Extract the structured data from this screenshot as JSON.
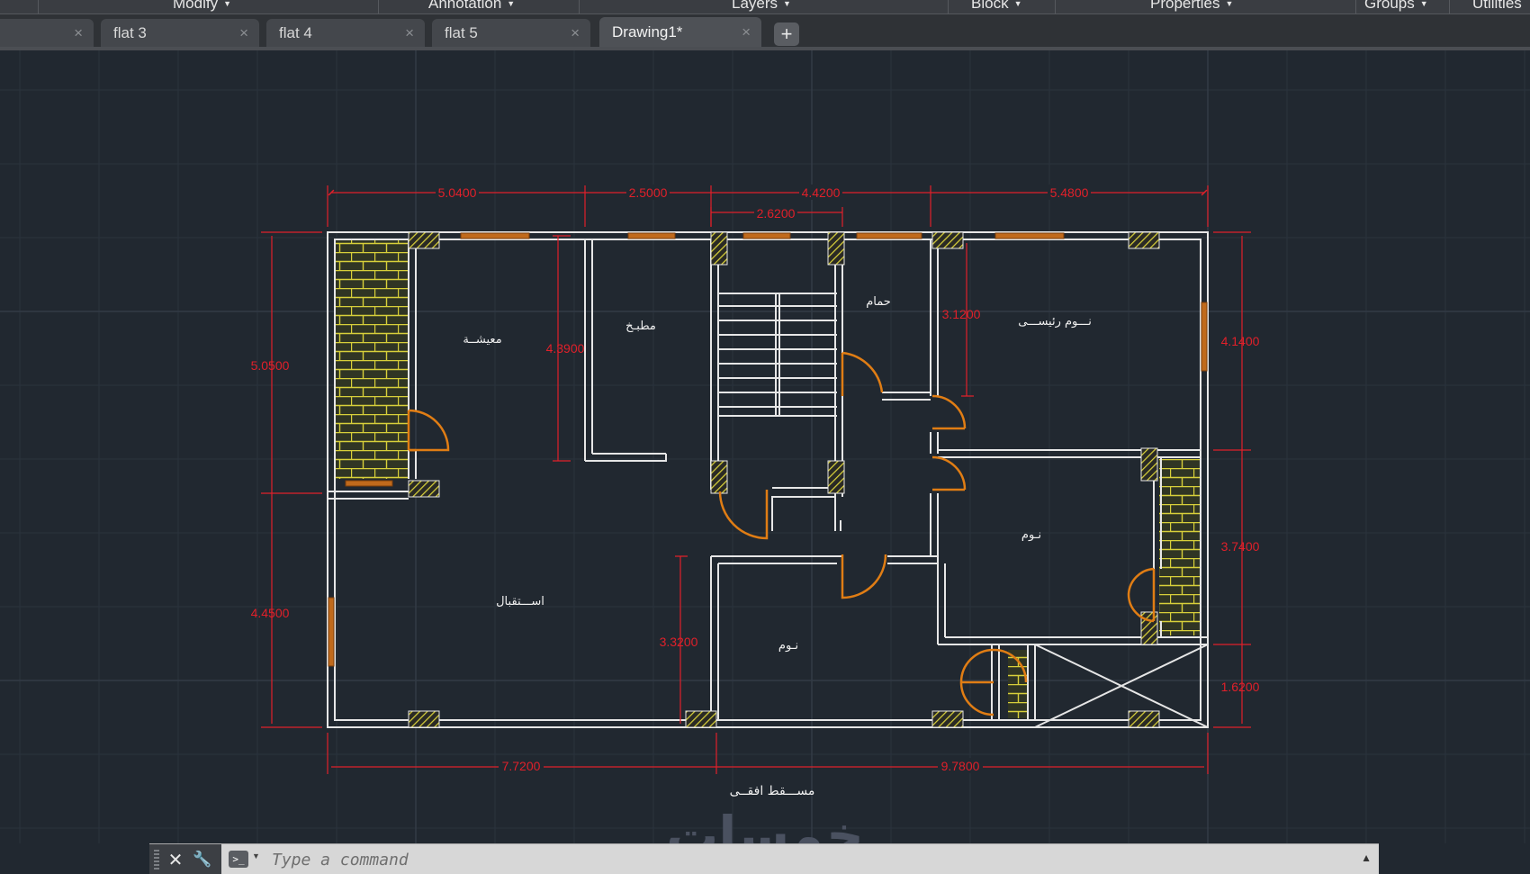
{
  "ribbon": {
    "panels": [
      {
        "label": "Modify"
      },
      {
        "label": "Annotation"
      },
      {
        "label": "Layers"
      },
      {
        "label": "Block"
      },
      {
        "label": "Properties"
      },
      {
        "label": "Groups"
      },
      {
        "label": "Utilities"
      }
    ]
  },
  "tabs": [
    {
      "label": ""
    },
    {
      "label": "flat 3"
    },
    {
      "label": "flat 4"
    },
    {
      "label": "flat 5"
    },
    {
      "label": "Drawing1*",
      "active": true
    }
  ],
  "tab_close_glyph": "×",
  "new_tab_glyph": "+",
  "drawing": {
    "title": "مســـقط افقــى",
    "watermark": "خمسات",
    "dimensions": {
      "top": [
        "5.0400",
        "2.5000",
        "4.4200",
        "5.4800"
      ],
      "top_inner": "2.6200",
      "left": [
        "5.0500",
        "4.4500"
      ],
      "right": [
        "4.1400",
        "3.7400",
        "1.6200"
      ],
      "bottom": [
        "7.7200",
        "9.7800"
      ],
      "interior": [
        "4.3900",
        "3.1200",
        "3.3200"
      ]
    },
    "rooms": {
      "living": "معيشــة",
      "kitchen": "مطبـخ",
      "bathroom": "حمام",
      "master_bedroom": "نـــوم رئيســـى",
      "bedroom_right": "نـوم",
      "reception": "اســـتقبال",
      "bedroom_center": "نـوم"
    },
    "colors": {
      "background": "#212830",
      "grid": "#2b333d",
      "walls": "#e6e6e6",
      "dimension": "#e0202a",
      "doors": "#e07d14",
      "hatch": "#d8d03a",
      "text": "#f0f0f0"
    }
  },
  "command": {
    "placeholder": "Type a command",
    "close_glyph": "✕",
    "wrench_glyph": "🔧",
    "prompt_glyph": ">_",
    "expand_glyph": "▲"
  }
}
